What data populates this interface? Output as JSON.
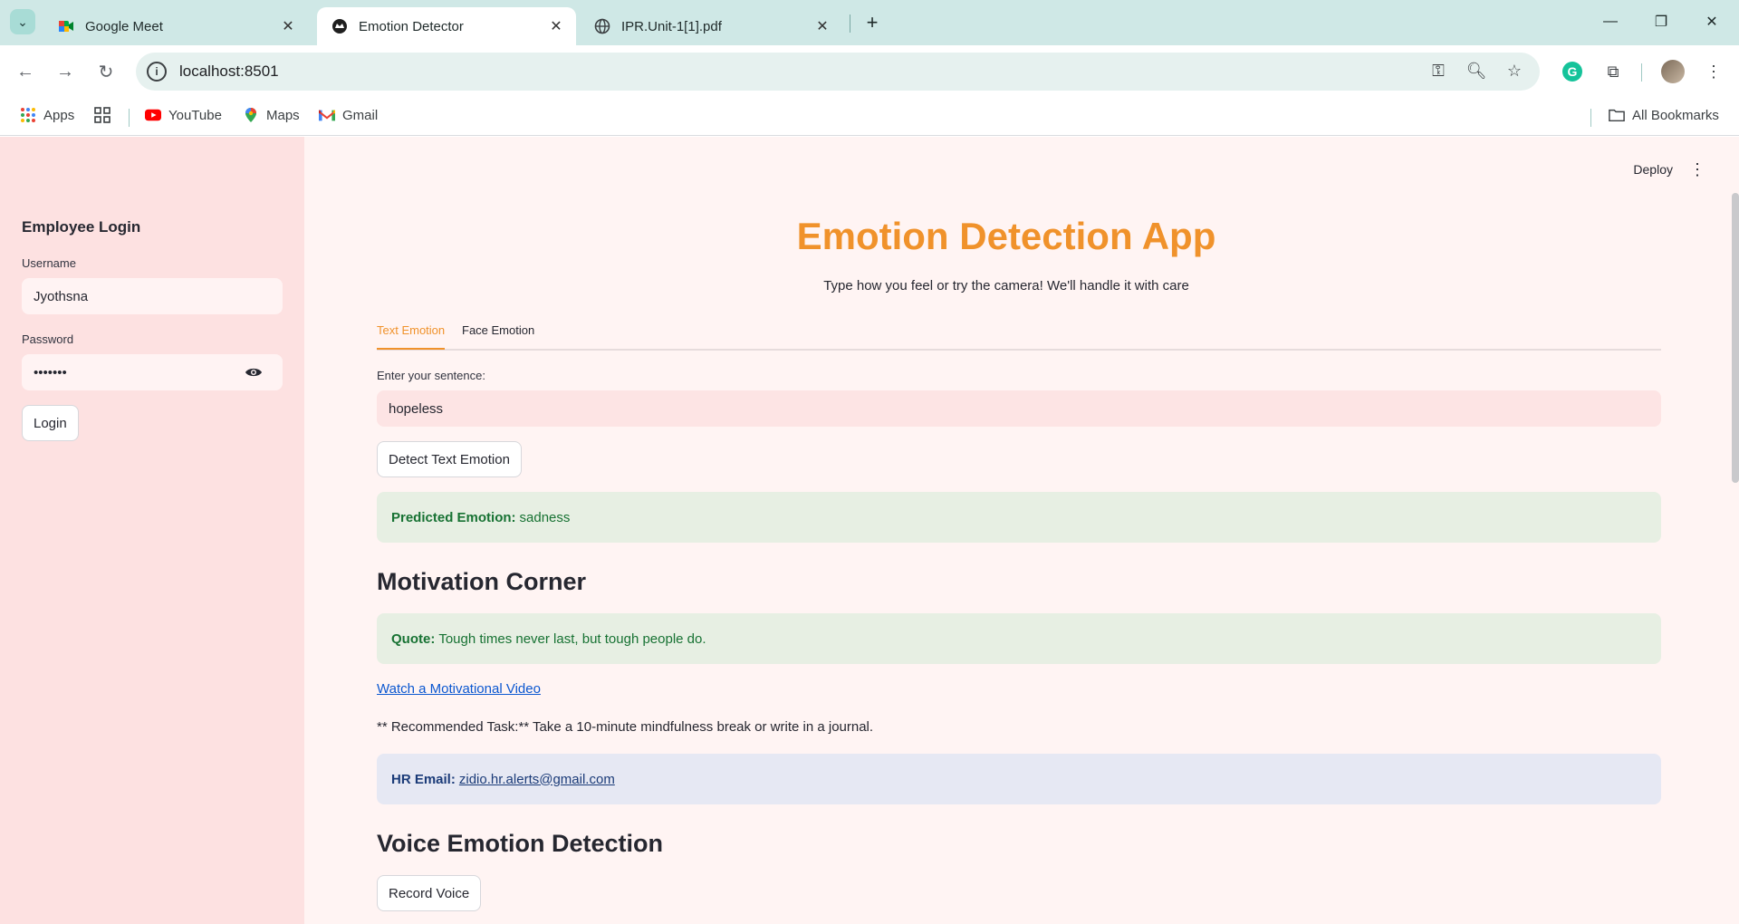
{
  "browser": {
    "tabs": [
      {
        "title": "Google Meet",
        "icon": "google-meet-icon",
        "active": false
      },
      {
        "title": "Emotion Detector",
        "icon": "streamlit-icon",
        "active": true
      },
      {
        "title": "IPR.Unit-1[1].pdf",
        "icon": "globe-icon",
        "active": false
      }
    ],
    "url": "localhost:8501",
    "bookmarks": {
      "apps": "Apps",
      "youtube": "YouTube",
      "maps": "Maps",
      "gmail": "Gmail",
      "all": "All Bookmarks"
    }
  },
  "sidebar": {
    "heading": "Employee Login",
    "username_label": "Username",
    "username_value": "Jyothsna",
    "password_label": "Password",
    "password_value": "•••••••",
    "login_label": "Login"
  },
  "header": {
    "deploy_label": "Deploy"
  },
  "main": {
    "title": "Emotion Detection App",
    "subtitle": "Type how you feel or try the camera! We'll handle it with care",
    "tabs": [
      {
        "label": "Text Emotion",
        "active": true
      },
      {
        "label": "Face Emotion",
        "active": false
      }
    ],
    "input_label": "Enter your sentence:",
    "input_value": "hopeless",
    "detect_button": "Detect Text Emotion",
    "prediction_label": "Predicted Emotion:",
    "prediction_value": "sadness",
    "motivation_heading": "Motivation Corner",
    "quote_label": "Quote:",
    "quote_text": "Tough times never last, but tough people do.",
    "video_link": "Watch a Motivational Video",
    "task_text": "** Recommended Task:** Take a 10-minute mindfulness break or write in a journal.",
    "hr_label": "HR Email:",
    "hr_email": "zidio.hr.alerts@gmail.com",
    "voice_heading": "Voice Emotion Detection",
    "record_button": "Record Voice"
  },
  "colors": {
    "accent": "#f0922b",
    "sidebar_bg": "#fde1e1",
    "main_bg": "#fff4f3",
    "success_bg": "#e7efe3",
    "success_text": "#177233",
    "info_bg": "#e6e8f3"
  }
}
